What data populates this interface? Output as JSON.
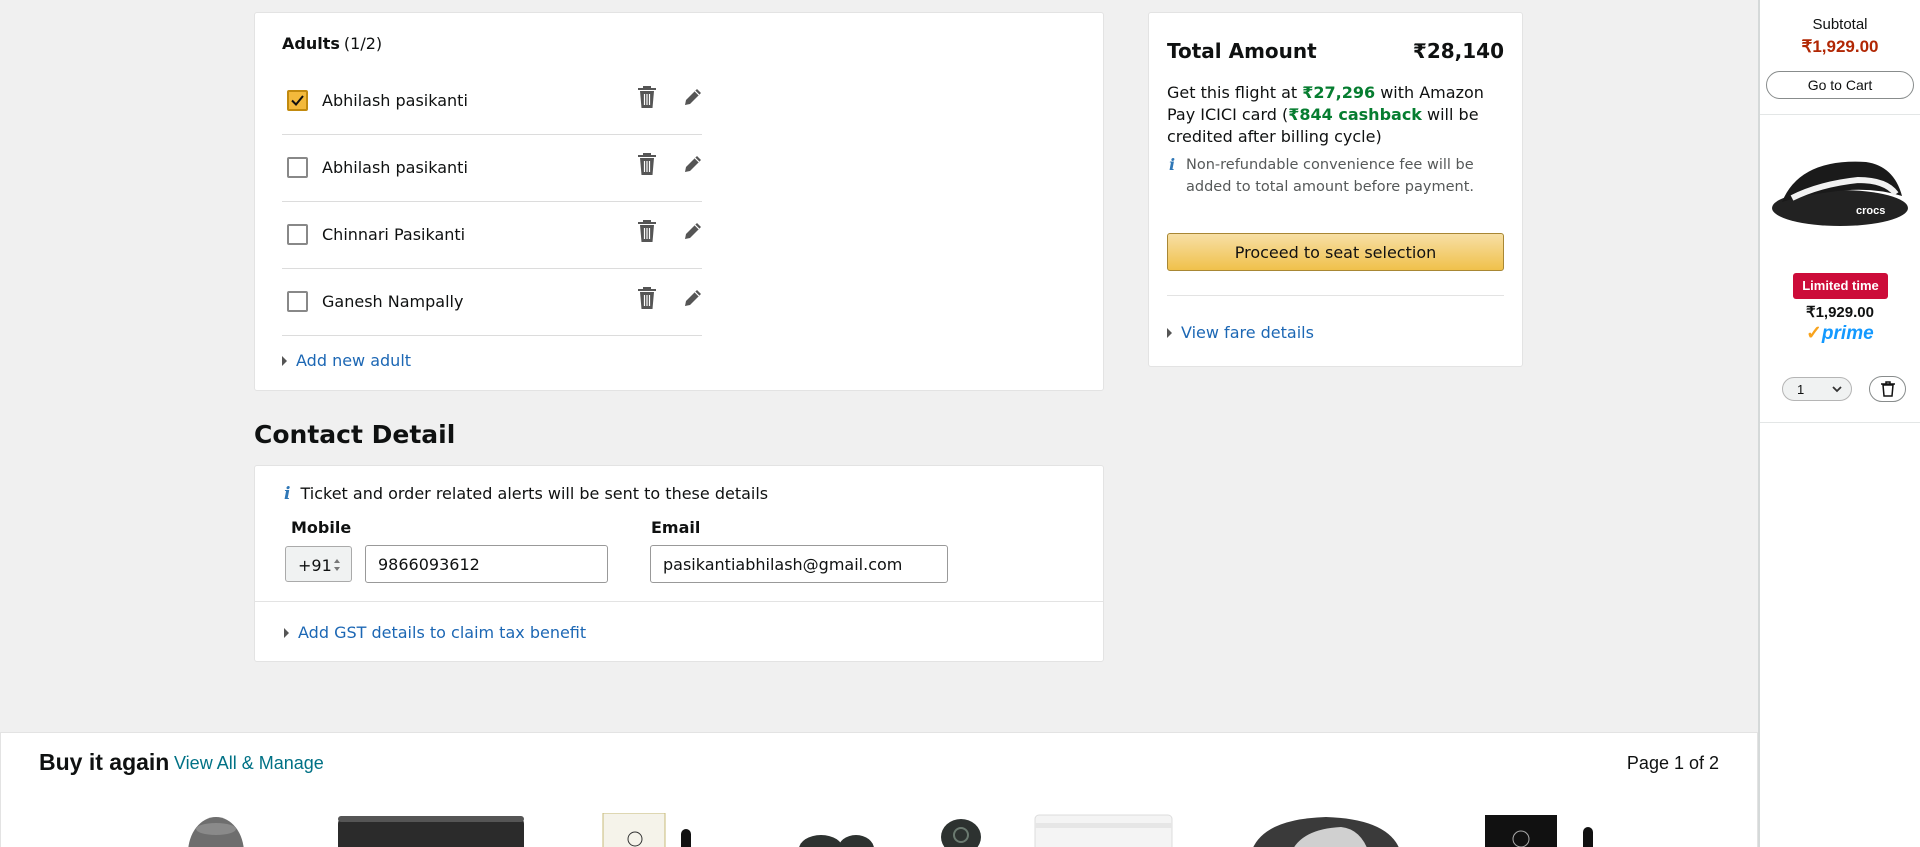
{
  "adults": {
    "heading": "Adults",
    "count": "(1/2)",
    "travellers": [
      {
        "name": "Abhilash pasikanti",
        "checked": true
      },
      {
        "name": "Abhilash pasikanti",
        "checked": false
      },
      {
        "name": "Chinnari Pasikanti",
        "checked": false
      },
      {
        "name": "Ganesh Nampally",
        "checked": false
      }
    ],
    "add_label": "Add new adult"
  },
  "contact": {
    "heading": "Contact Detail",
    "note": "Ticket and order related alerts will be sent to these details",
    "mobile_label": "Mobile",
    "country_code": "+91",
    "mobile_value": "9866093612",
    "email_label": "Email",
    "email_value": "pasikantiabhilash@gmail.com",
    "gst_label": "Add GST details to claim tax benefit"
  },
  "summary": {
    "total_label": "Total Amount",
    "total_value": "₹28,140",
    "offer_prefix": "Get this flight at ",
    "offer_price": "₹27,296",
    "offer_middle": " with Amazon Pay ICICI card (",
    "offer_cashback": "₹844 cashback",
    "offer_suffix": " will be credited after billing cycle)",
    "fee_note": "Non-refundable convenience fee will be added to total amount before payment.",
    "proceed_label": "Proceed to seat selection",
    "fare_link": "View fare details"
  },
  "buy_again": {
    "title": "Buy it again",
    "link": "View All & Manage",
    "page_info": "Page 1 of 2"
  },
  "cart": {
    "subtotal_label": "Subtotal",
    "subtotal_value": "₹1,929.00",
    "go_to_cart": "Go to Cart",
    "badge": "Limited time",
    "price": "₹1,929.00",
    "prime": "prime",
    "quantity": "1"
  },
  "colors": {
    "link": "#1c67b4",
    "cashback_green": "#067d30",
    "price_red": "#b12704",
    "badge_red": "#cc0c39",
    "button_yellow": "#f0c14b"
  }
}
